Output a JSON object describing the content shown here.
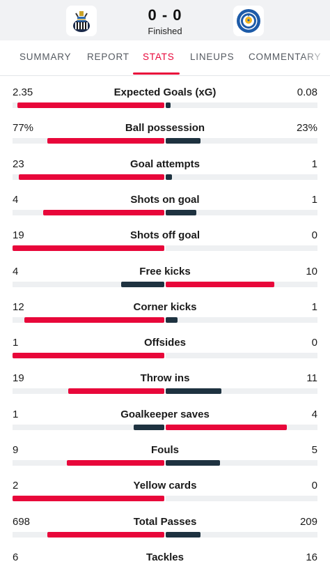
{
  "match": {
    "score": "0 - 0",
    "status": "Finished",
    "home_logo": "newcastle-united-crest",
    "away_logo": "leicester-city-crest"
  },
  "tabs": [
    {
      "label": "SUMMARY",
      "active": false
    },
    {
      "label": "REPORT",
      "active": false
    },
    {
      "label": "STATS",
      "active": true
    },
    {
      "label": "LINEUPS",
      "active": false
    },
    {
      "label": "COMMENTARY",
      "active": false
    }
  ],
  "colors": {
    "accent": "#e8073a",
    "home_bar_winning": "#e8073a",
    "bar_losing": "#1e3240",
    "track": "#eef0f2"
  },
  "stats": [
    {
      "label": "Expected Goals (xG)",
      "home": "2.35",
      "away": "0.08",
      "home_share": 0.967,
      "away_share": 0.033
    },
    {
      "label": "Ball possession",
      "home": "77%",
      "away": "23%",
      "home_share": 0.77,
      "away_share": 0.23
    },
    {
      "label": "Goal attempts",
      "home": "23",
      "away": "1",
      "home_share": 0.958,
      "away_share": 0.042
    },
    {
      "label": "Shots on goal",
      "home": "4",
      "away": "1",
      "home_share": 0.8,
      "away_share": 0.2
    },
    {
      "label": "Shots off goal",
      "home": "19",
      "away": "0",
      "home_share": 1.0,
      "away_share": 0.0
    },
    {
      "label": "Free kicks",
      "home": "4",
      "away": "10",
      "home_share": 0.286,
      "away_share": 0.714
    },
    {
      "label": "Corner kicks",
      "home": "12",
      "away": "1",
      "home_share": 0.923,
      "away_share": 0.077
    },
    {
      "label": "Offsides",
      "home": "1",
      "away": "0",
      "home_share": 1.0,
      "away_share": 0.0
    },
    {
      "label": "Throw ins",
      "home": "19",
      "away": "11",
      "home_share": 0.633,
      "away_share": 0.367
    },
    {
      "label": "Goalkeeper saves",
      "home": "1",
      "away": "4",
      "home_share": 0.2,
      "away_share": 0.8
    },
    {
      "label": "Fouls",
      "home": "9",
      "away": "5",
      "home_share": 0.643,
      "away_share": 0.357
    },
    {
      "label": "Yellow cards",
      "home": "2",
      "away": "0",
      "home_share": 1.0,
      "away_share": 0.0
    },
    {
      "label": "Total Passes",
      "home": "698",
      "away": "209",
      "home_share": 0.77,
      "away_share": 0.23
    },
    {
      "label": "Tackles",
      "home": "6",
      "away": "16",
      "home_share": 0.273,
      "away_share": 0.727
    }
  ]
}
